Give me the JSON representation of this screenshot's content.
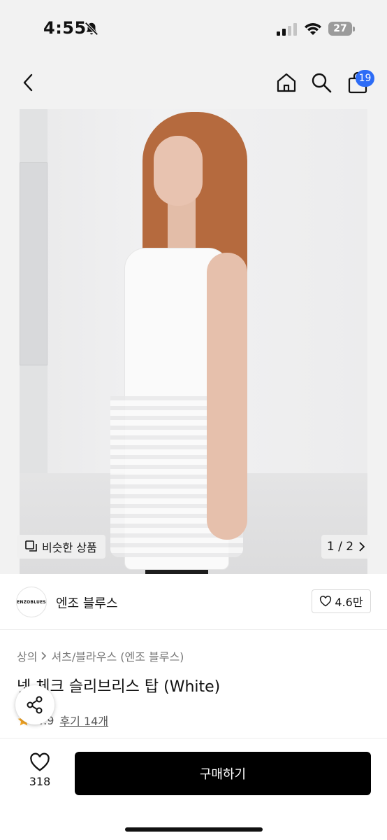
{
  "status_bar": {
    "time": "4:55",
    "battery": "27"
  },
  "nav": {
    "cart_count": "19"
  },
  "gallery": {
    "similar_label": "비슷한 상품",
    "pager": "1 / 2"
  },
  "brand": {
    "logo_text": "ENZOBLUES",
    "name": "엔조 블루스",
    "likes": "4.6만"
  },
  "product": {
    "breadcrumb": [
      "상의",
      "셔츠/블라우스 (엔조 블루스)"
    ],
    "title": "넷 체크 슬리브리스 탑 (White)",
    "rating": "4.9",
    "reviews": "후기 14개"
  },
  "bottom": {
    "wish_count": "318",
    "buy_label": "구매하기"
  },
  "colors": {
    "accent_badge": "#2d6cf6",
    "star": "#f5a623",
    "buy_button": "#000000"
  }
}
